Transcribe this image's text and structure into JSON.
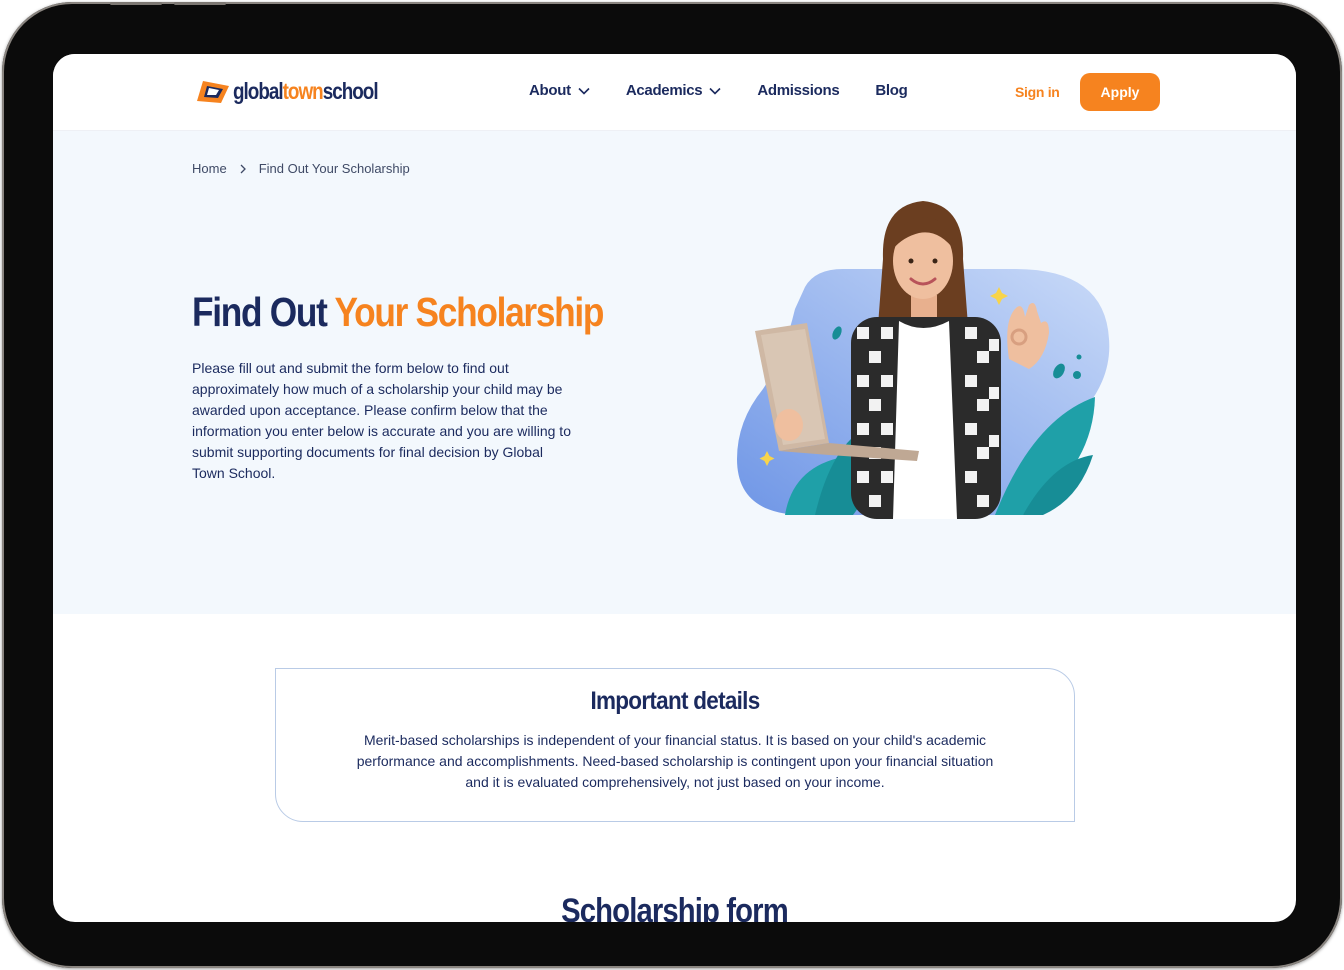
{
  "header": {
    "logo": {
      "part1": "global",
      "part2": "town",
      "part3": "school"
    },
    "nav": [
      {
        "label": "About",
        "has_dropdown": true
      },
      {
        "label": "Academics",
        "has_dropdown": true
      },
      {
        "label": "Admissions",
        "has_dropdown": false
      },
      {
        "label": "Blog",
        "has_dropdown": false
      }
    ],
    "signin_label": "Sign in",
    "apply_label": "Apply"
  },
  "breadcrumb": {
    "home": "Home",
    "current": "Find Out Your Scholarship"
  },
  "hero": {
    "title_part1": "Find Out",
    "title_part2": "Your Scholarship",
    "description": "Please fill out and submit the form below to find out approximately how much of a scholarship your child may be awarded upon acceptance. Please confirm below that the information you enter below is accurate and you are willing to submit supporting documents for final decision by Global Town School."
  },
  "details": {
    "title": "Important details",
    "text": "Merit-based scholarships is independent of your financial status. It is based on your child's academic performance and accomplishments. Need-based scholarship is contingent upon your financial situation and it is evaluated comprehensively, not just based on your income."
  },
  "form": {
    "title": "Scholarship form"
  },
  "colors": {
    "navy": "#1b2a5e",
    "orange": "#f6831f",
    "hero_bg": "#f3f8fd",
    "blob": "#7ea3ea",
    "leaf": "#1fa0a8"
  }
}
